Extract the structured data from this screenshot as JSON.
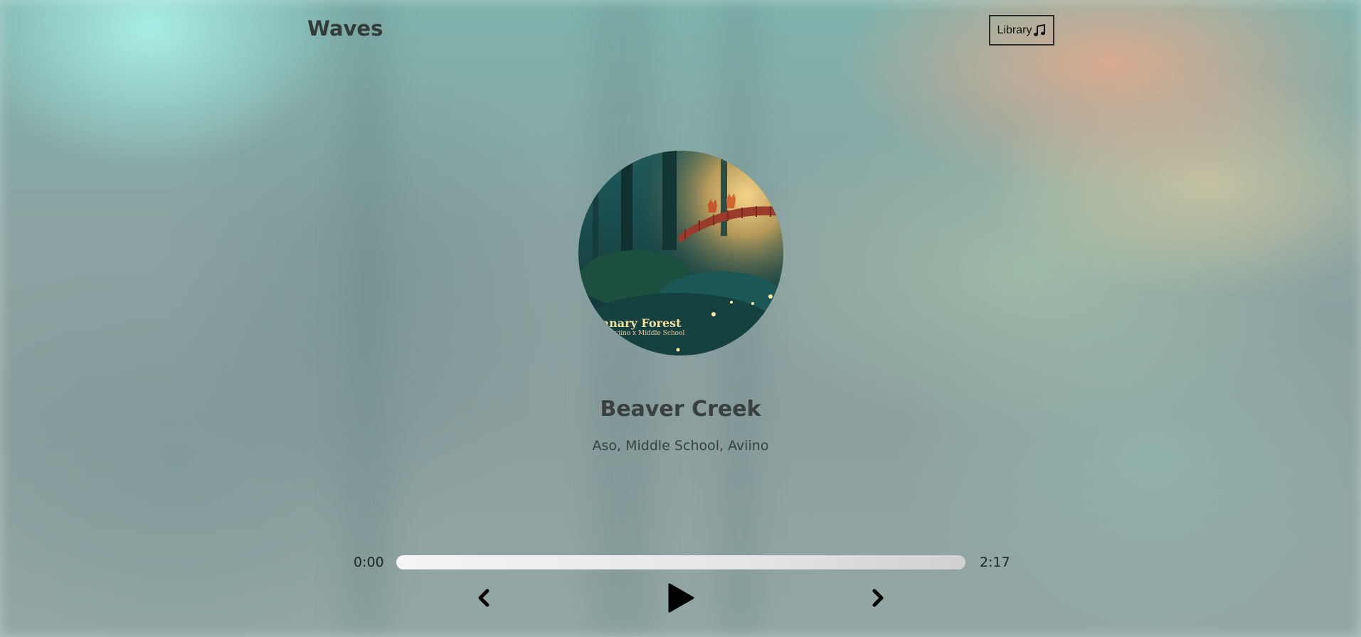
{
  "app": {
    "title": "Waves",
    "library_label": "Library",
    "library_icon": "music-note-icon"
  },
  "song": {
    "title": "Beaver Creek",
    "artist": "Aso, Middle School, Aviino",
    "cover_art_title": "Canary Forest",
    "cover_art_subtitle": "Aviino x Middle School"
  },
  "player": {
    "current_time": "0:00",
    "total_time": "2:17",
    "progress": 0,
    "prev_icon": "chevron-left-icon",
    "play_icon": "play-icon",
    "next_icon": "chevron-right-icon"
  },
  "colors": {
    "text_dark": "#3a3f40",
    "track": "#e6e6e6"
  }
}
